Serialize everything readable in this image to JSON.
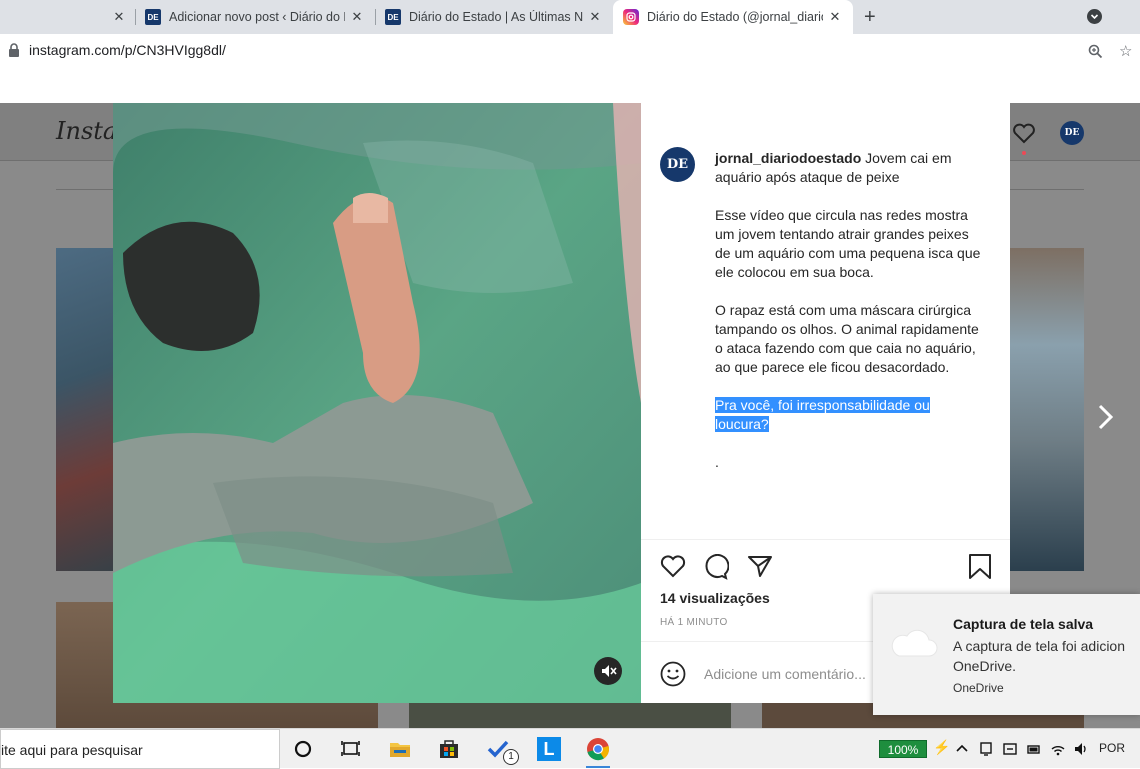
{
  "browser": {
    "tabs": [
      {
        "title": "Adicionar novo post ‹ Diário do E",
        "favicon": "DE"
      },
      {
        "title": "Diário do Estado | As Últimas Not",
        "favicon": "DE"
      },
      {
        "title": "Diário do Estado (@jornal_diarioc",
        "favicon": "instagram"
      }
    ],
    "url": "instagram.com/p/CN3HVIgg8dl/"
  },
  "instagram": {
    "logo": "Insta",
    "header_avatar": "DE",
    "post": {
      "avatar": "DE",
      "username": "jornal_diariodoestado",
      "title": " Jovem cai em aquário após ataque de peixe",
      "paragraph1": "Esse vídeo que circula nas redes mostra um jovem tentando atrair grandes peixes de um aquário com uma pequena isca que ele colocou em sua boca.",
      "paragraph2": "O rapaz está com uma máscara cirúrgica tampando os olhos. O animal rapidamente o ataca fazendo com que caia no aquário, ao que parece ele ficou desacordado.",
      "question": "Pra você, foi irresponsabilidade ou loucura?",
      "dot": ".",
      "views": "14 visualizações",
      "time": "HÁ 1 MINUTO",
      "comment_placeholder": "Adicione um comentário..."
    }
  },
  "toast": {
    "title": "Captura de tela salva",
    "body": "A captura de tela foi adicion\nOneDrive.",
    "source": "OneDrive"
  },
  "taskbar": {
    "search": "ite aqui para pesquisar",
    "battery": "100%",
    "lang": "POR",
    "badge": "1"
  },
  "colors": {
    "brand": "#16386b",
    "highlight": "#3390ff"
  }
}
